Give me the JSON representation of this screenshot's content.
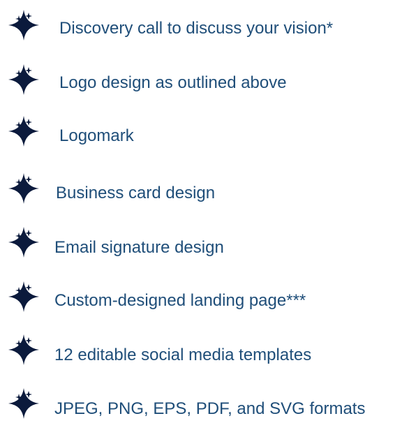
{
  "colors": {
    "text": "#1F4E79",
    "sparkle": "#0B1A3C"
  },
  "bullet_icon": "four-point-sparkle-icon",
  "items": [
    {
      "label": "Discovery call to discuss your vision*"
    },
    {
      "label": "Logo design as outlined above"
    },
    {
      "label": "Logomark"
    },
    {
      "label": "Business card design"
    },
    {
      "label": "Email signature design"
    },
    {
      "label": "Custom-designed landing page***"
    },
    {
      "label": "12 editable social media templates"
    },
    {
      "label": "JPEG, PNG, EPS, PDF, and SVG formats"
    }
  ]
}
